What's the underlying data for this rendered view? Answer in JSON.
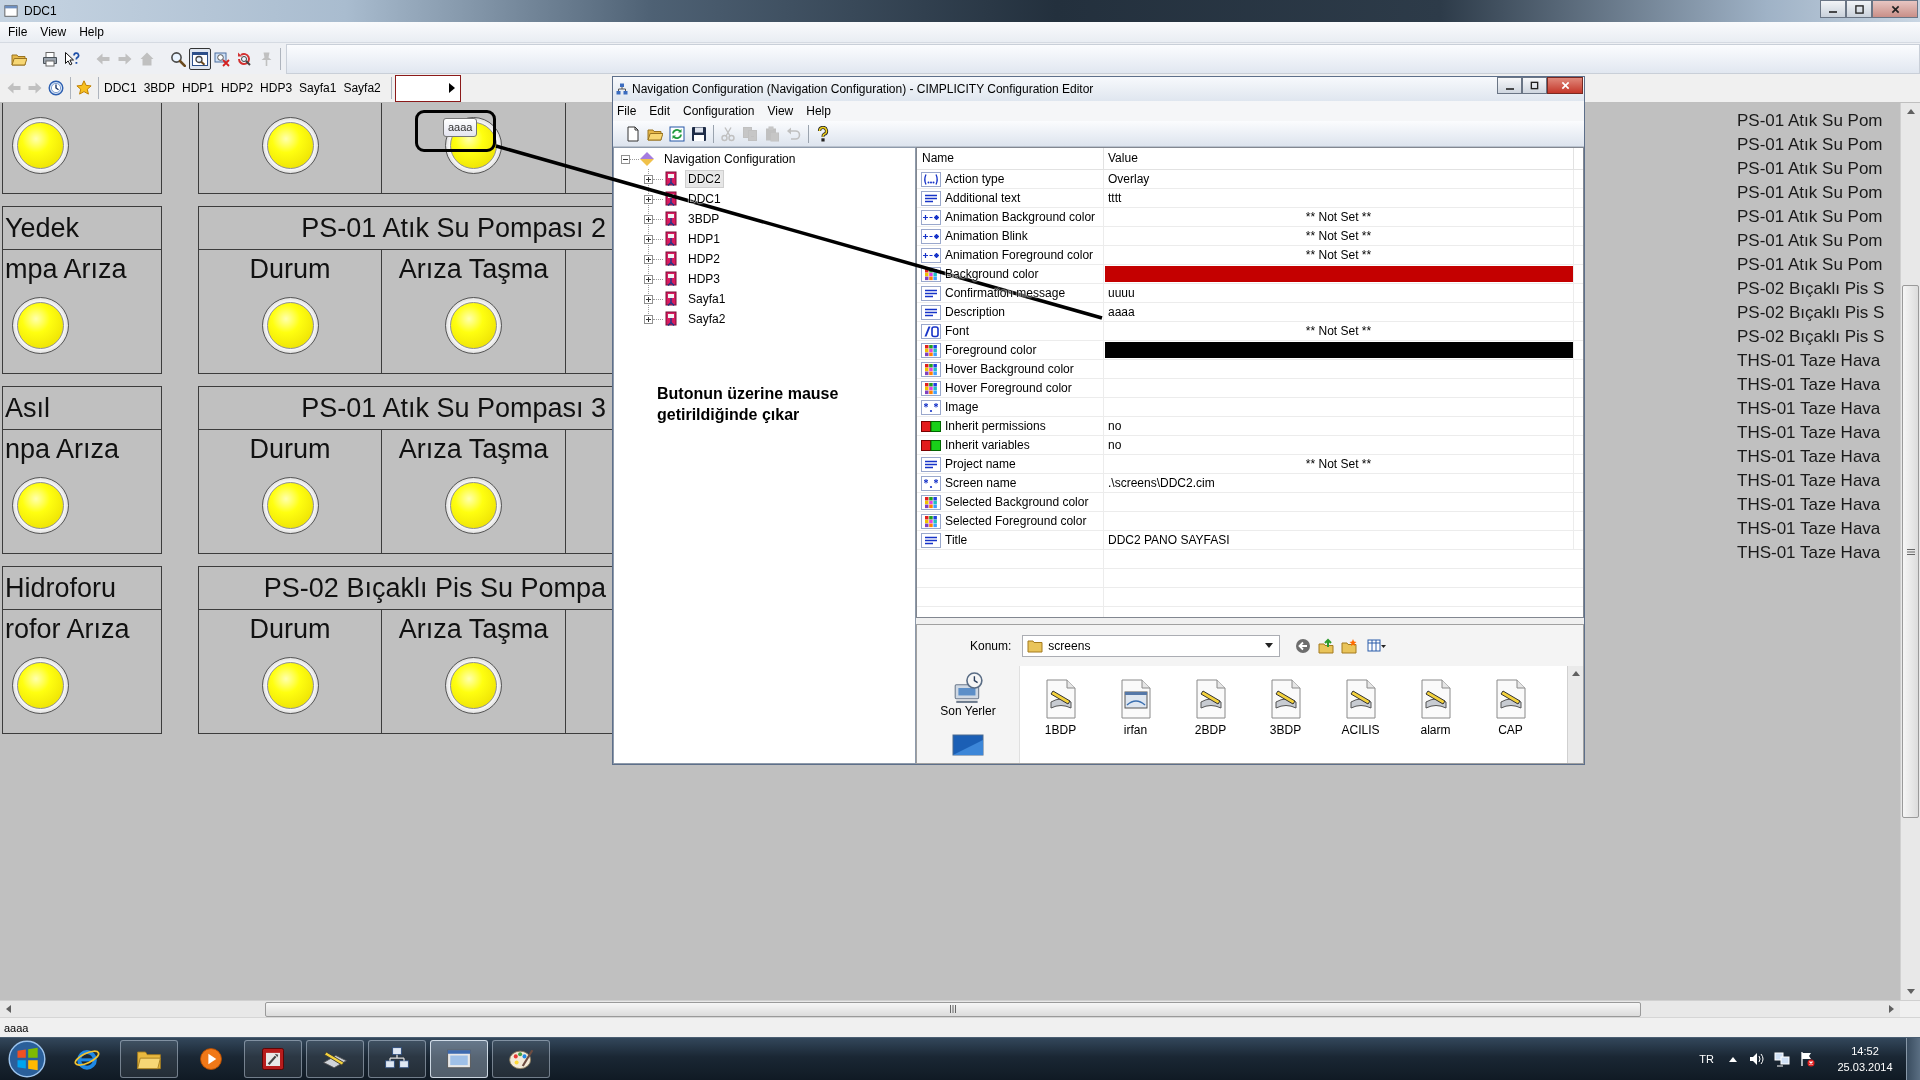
{
  "app": {
    "title": "DDC1",
    "menu": [
      "File",
      "View",
      "Help"
    ],
    "toolbar": [
      {
        "kind": "open",
        "disabled": false,
        "pressed": false
      },
      {
        "kind": "print",
        "disabled": false,
        "pressed": false
      },
      {
        "kind": "context-help",
        "disabled": false,
        "pressed": false
      },
      {
        "kind": "back",
        "disabled": true,
        "pressed": false
      },
      {
        "kind": "forward",
        "disabled": true,
        "pressed": false
      },
      {
        "kind": "home",
        "disabled": true,
        "pressed": false
      },
      {
        "kind": "zoom",
        "disabled": false,
        "pressed": false
      },
      {
        "kind": "zoom-window",
        "disabled": false,
        "pressed": true
      },
      {
        "kind": "zoom-fit",
        "disabled": false,
        "pressed": false
      },
      {
        "kind": "zoom-reset",
        "disabled": false,
        "pressed": false
      },
      {
        "kind": "pin",
        "disabled": true,
        "pressed": false
      }
    ],
    "nav_buttons": [
      {
        "kind": "back",
        "disabled": true
      },
      {
        "kind": "forward",
        "disabled": true
      },
      {
        "kind": "history",
        "disabled": false
      },
      {
        "kind": "favorite",
        "disabled": false
      }
    ],
    "nav_links": [
      "DDC1",
      "3BDP",
      "HDP1",
      "HDP2",
      "HDP3",
      "Sayfa1",
      "Sayfa2"
    ],
    "status_text": "aaaa"
  },
  "canvas": {
    "groups": [
      {
        "side_cell": {
          "lit": true
        },
        "cells": [
          {
            "lit": true
          },
          {
            "lit": true,
            "tooltip": "aaaa"
          }
        ]
      },
      {
        "side_title": "Yedek",
        "title": "PS-01 Atık Su Pompası 2",
        "side_cell": {
          "label": "mpa Arıza",
          "lit": true
        },
        "cells": [
          {
            "label": "Durum",
            "lit": true
          },
          {
            "label": "Arıza Taşma",
            "lit": true
          }
        ]
      },
      {
        "side_title": "Asıl",
        "title": "PS-01 Atık Su Pompası 3",
        "side_cell": {
          "label": "npa Arıza",
          "lit": true
        },
        "cells": [
          {
            "label": "Durum",
            "lit": true
          },
          {
            "label": "Arıza Taşma",
            "lit": true
          }
        ]
      },
      {
        "side_title": "Hidroforu",
        "title": "PS-02 Bıçaklı Pis Su Pompa",
        "side_cell": {
          "label": "rofor Arıza",
          "lit": true
        },
        "cells": [
          {
            "label": "Durum",
            "lit": true
          },
          {
            "label": "Arıza Taşma",
            "lit": true
          }
        ]
      }
    ],
    "tag_list": [
      "PS-01 Atık Su Pom",
      "PS-01 Atık Su Pom",
      "PS-01 Atık Su Pom",
      "PS-01 Atık Su Pom",
      "PS-01 Atık Su Pom",
      "PS-01 Atık Su Pom",
      "PS-01 Atık Su Pom",
      "PS-02 Bıçaklı Pis S",
      "PS-02 Bıçaklı Pis S",
      "PS-02 Bıçaklı Pis S",
      "THS-01 Taze Hava",
      "THS-01 Taze Hava",
      "THS-01 Taze Hava",
      "THS-01 Taze Hava",
      "THS-01 Taze Hava",
      "THS-01 Taze Hava",
      "THS-01 Taze Hava",
      "THS-01 Taze Hava",
      "THS-01 Taze Hava"
    ]
  },
  "dialog": {
    "title": "Navigation Configuration (Navigation Configuration) - CIMPLICITY Configuration Editor",
    "menu": [
      "File",
      "Edit",
      "Configuration",
      "View",
      "Help"
    ],
    "toolbar": [
      {
        "kind": "new",
        "disabled": false
      },
      {
        "kind": "open",
        "disabled": false
      },
      {
        "kind": "refresh",
        "disabled": false
      },
      {
        "kind": "save",
        "disabled": false
      },
      {
        "kind": "cut",
        "disabled": true
      },
      {
        "kind": "copy",
        "disabled": true
      },
      {
        "kind": "paste",
        "disabled": true
      },
      {
        "kind": "undo",
        "disabled": true
      },
      {
        "kind": "help",
        "disabled": false
      }
    ],
    "tree": {
      "label": "Navigation Configuration",
      "expanded": true,
      "selected": false,
      "children": [
        {
          "label": "DDC2",
          "expanded": false,
          "selected": true
        },
        {
          "label": "DDC1",
          "expanded": false,
          "selected": false
        },
        {
          "label": "3BDP",
          "expanded": false,
          "selected": false
        },
        {
          "label": "HDP1",
          "expanded": false,
          "selected": false
        },
        {
          "label": "HDP2",
          "expanded": false,
          "selected": false
        },
        {
          "label": "HDP3",
          "expanded": false,
          "selected": false
        },
        {
          "label": "Sayfa1",
          "expanded": false,
          "selected": false
        },
        {
          "label": "Sayfa2",
          "expanded": false,
          "selected": false
        }
      ]
    },
    "columns": [
      "Name",
      "Value"
    ],
    "properties": [
      {
        "name": "Action type",
        "kind": "choice",
        "value": "Overlay"
      },
      {
        "name": "Additional text",
        "kind": "text",
        "value": "tttt"
      },
      {
        "name": "Animation Background color",
        "kind": "animation",
        "placeholder": "** Not Set **"
      },
      {
        "name": "Animation Blink",
        "kind": "animation",
        "placeholder": "** Not Set **"
      },
      {
        "name": "Animation Foreground color",
        "kind": "animation",
        "placeholder": "** Not Set **"
      },
      {
        "name": "Background color",
        "kind": "color",
        "color": "#c40000"
      },
      {
        "name": "Confirmation message",
        "kind": "text",
        "value": "uuuu"
      },
      {
        "name": "Description",
        "kind": "text",
        "value": "aaaa"
      },
      {
        "name": "Font",
        "kind": "font",
        "placeholder": "** Not Set **"
      },
      {
        "name": "Foreground color",
        "kind": "color",
        "color": "#000000"
      },
      {
        "name": "Hover Background color",
        "kind": "color"
      },
      {
        "name": "Hover Foreground color",
        "kind": "color"
      },
      {
        "name": "Image",
        "kind": "file"
      },
      {
        "name": "Inherit permissions",
        "kind": "boolean",
        "value": "no"
      },
      {
        "name": "Inherit variables",
        "kind": "boolean",
        "value": "no"
      },
      {
        "name": "Project name",
        "kind": "text",
        "placeholder": "** Not Set **"
      },
      {
        "name": "Screen name",
        "kind": "file",
        "value": ".\\screens\\DDC2.cim"
      },
      {
        "name": "Selected Background color",
        "kind": "color"
      },
      {
        "name": "Selected Foreground color",
        "kind": "color"
      },
      {
        "name": "Title",
        "kind": "text",
        "value": "DDC2 PANO SAYFASI"
      }
    ],
    "browser": {
      "location_label": "Konum:",
      "location": "screens",
      "places": [
        {
          "kind": "recent",
          "label": "Son Yerler"
        },
        {
          "kind": "desktop"
        }
      ],
      "files": [
        {
          "kind": "screen",
          "label": "1BDP"
        },
        {
          "kind": "picture",
          "label": "irfan"
        },
        {
          "kind": "screen",
          "label": "2BDP"
        },
        {
          "kind": "screen",
          "label": "3BDP"
        },
        {
          "kind": "screen",
          "label": "ACILIS"
        },
        {
          "kind": "screen",
          "label": "alarm"
        },
        {
          "kind": "screen",
          "label": "CAP"
        }
      ]
    }
  },
  "annotation": {
    "note": "Butonun üzerine mause getirildiğinde çıkar"
  },
  "taskbar": {
    "apps": [
      {
        "kind": "browser",
        "running": false,
        "selected": false
      },
      {
        "kind": "folder",
        "running": true,
        "selected": false
      },
      {
        "kind": "media",
        "running": false,
        "selected": false
      },
      {
        "kind": "tools",
        "running": true,
        "selected": false
      },
      {
        "kind": "editor",
        "running": true,
        "selected": false
      },
      {
        "kind": "network",
        "running": true,
        "selected": false
      },
      {
        "kind": "viewer",
        "running": true,
        "selected": true
      },
      {
        "kind": "paint",
        "running": true,
        "selected": false
      }
    ],
    "language": "TR",
    "time": "14:52",
    "date": "25.03.2014"
  }
}
